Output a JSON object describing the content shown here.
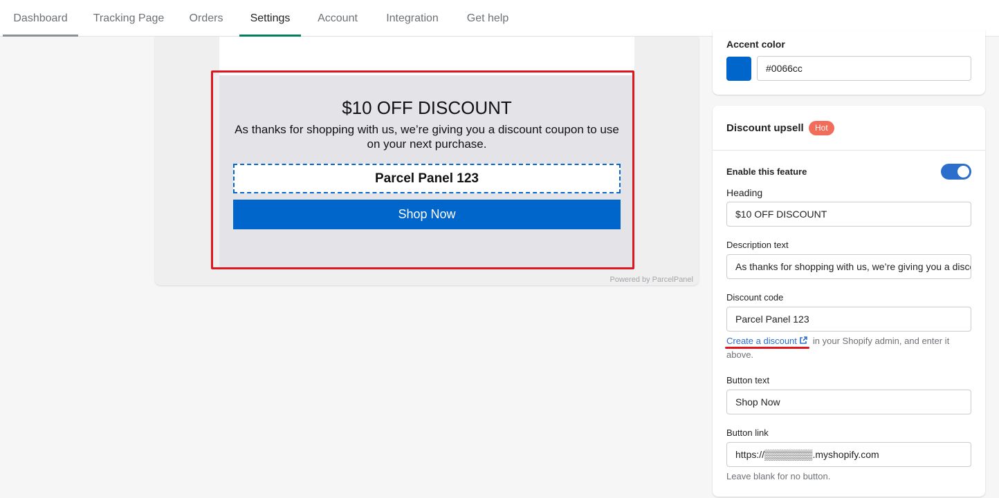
{
  "nav": {
    "tabs": [
      {
        "label": "Dashboard"
      },
      {
        "label": "Tracking Page"
      },
      {
        "label": "Orders"
      },
      {
        "label": "Settings"
      },
      {
        "label": "Account"
      },
      {
        "label": "Integration"
      },
      {
        "label": "Get help"
      }
    ]
  },
  "preview": {
    "heading": "$10 OFF DISCOUNT",
    "description": "As thanks for shopping with us, we’re giving you a discount coupon to use on your next purchase.",
    "code": "Parcel Panel 123",
    "button": "Shop Now",
    "powered": "Powered by ParcelPanel"
  },
  "accent": {
    "label": "Accent color",
    "value": "#0066cc",
    "color": "#0066cc"
  },
  "upsell": {
    "title": "Discount upsell",
    "badge": "Hot",
    "enable_label": "Enable this feature",
    "enabled": true,
    "heading_label": "Heading",
    "heading_value": "$10 OFF DISCOUNT",
    "description_label": "Description text",
    "description_value": "As thanks for shopping with us, we’re giving you a discount coupon to use on your next purchase.",
    "code_label": "Discount code",
    "code_value": "Parcel Panel 123",
    "create_link": "Create a discount",
    "create_help": "in your Shopify admin, and enter it above.",
    "button_text_label": "Button text",
    "button_text_value": "Shop Now",
    "button_link_label": "Button link",
    "button_link_value": "https://▒▒▒▒▒▒▒.myshopify.com",
    "button_link_help": "Leave blank for no button."
  }
}
